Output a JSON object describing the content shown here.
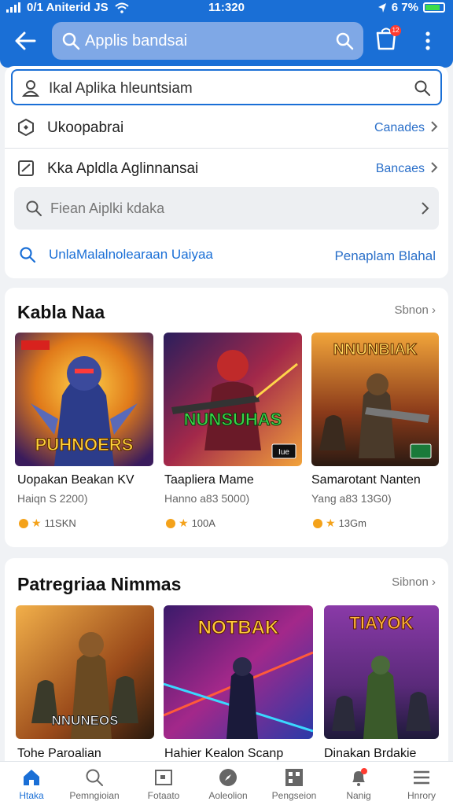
{
  "status": {
    "left": "0/1 Aniterid JS",
    "time": "11:320",
    "right": "6 7%"
  },
  "header": {
    "search_text": "Applis bandsai",
    "cart_badge": "12"
  },
  "search2": {
    "text": "Ikal Aplika hleuntsiam"
  },
  "rows": [
    {
      "label": "Ukoopabrai",
      "action": "Canades"
    },
    {
      "label": "Kka Apldla Aglinnansai",
      "action": "Bancaes"
    }
  ],
  "gray_input": {
    "placeholder": "Fiean Aiplki kdaka"
  },
  "link_row": {
    "label": "UnlaMalalnolearaan Uaiyaa",
    "action": "Penaplam Blahal"
  },
  "section1": {
    "title": "Kabla Naa",
    "more": "Sbnon",
    "items": [
      {
        "name": "Uopakan Beakan KV",
        "sub": "Haiqn S 2200)",
        "rating": "11SKN",
        "art_text": "PUHNOERS",
        "art_badge": ""
      },
      {
        "name": "Taapliera Mame",
        "sub": "Hanno a83 5000)",
        "rating": "100A",
        "art_text": "NUNSUHAS",
        "art_badge": "Iue"
      },
      {
        "name": "Samarotant Nanten",
        "sub": "Yang a83 13G0)",
        "rating": "13Gm",
        "art_text": "NNUNBIAK",
        "art_badge": ""
      }
    ]
  },
  "section2": {
    "title": "Patregriaa Nimmas",
    "more": "Sibnon",
    "items": [
      {
        "name": "Tohe Paroalian",
        "art_text": "NNUNEOS"
      },
      {
        "name": "Hahier Kealon Scanp",
        "art_text": "NOTBAK"
      },
      {
        "name": "Dinakan Brdakie",
        "art_text": "TIAYOK"
      }
    ]
  },
  "bottom_nav": [
    {
      "label": "Htaka",
      "icon": "home-icon",
      "active": true
    },
    {
      "label": "Pemngioian",
      "icon": "search-icon",
      "active": false
    },
    {
      "label": "Fotaato",
      "icon": "photo-icon",
      "active": false
    },
    {
      "label": "Aoleolion",
      "icon": "compass-icon",
      "active": false
    },
    {
      "label": "Pengseion",
      "icon": "apps-icon",
      "active": false
    },
    {
      "label": "Nanig",
      "icon": "bell-icon",
      "active": false
    },
    {
      "label": "Hnrory",
      "icon": "menu-icon",
      "active": false
    }
  ],
  "colors": {
    "brand": "#1a6fd6",
    "accent": "#f4a21a"
  }
}
